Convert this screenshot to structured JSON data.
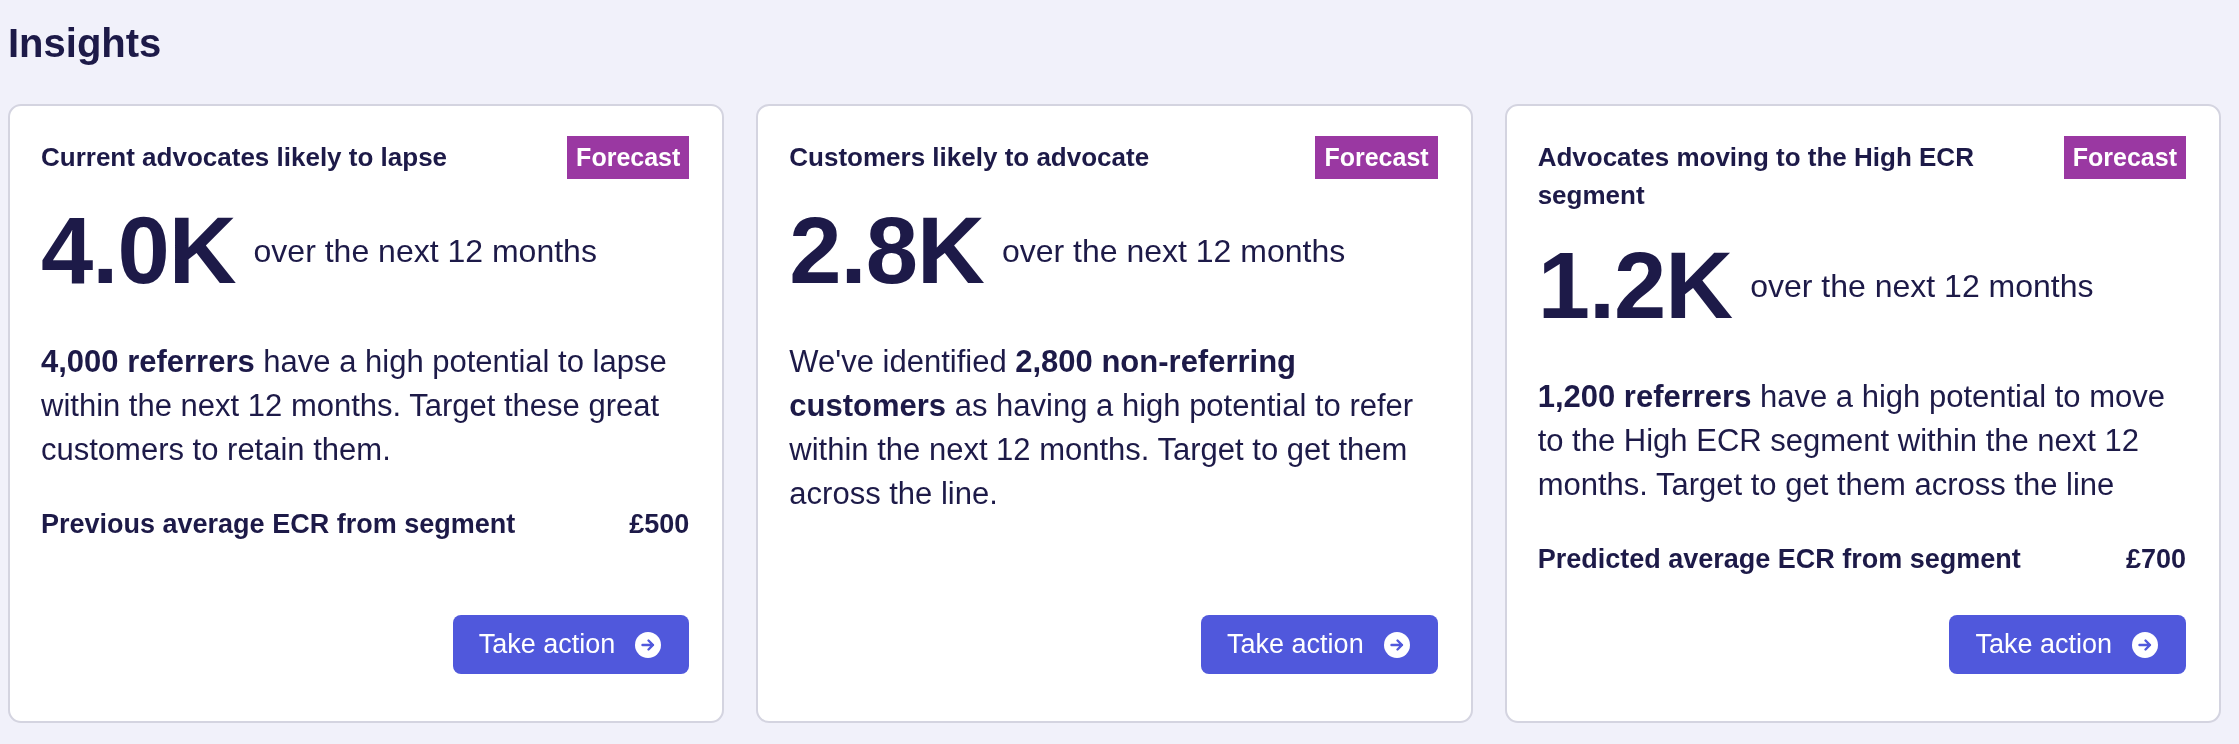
{
  "page": {
    "title": "Insights"
  },
  "cards": [
    {
      "title": "Current advocates likely to lapse",
      "badge": "Forecast",
      "value": "4.0K",
      "period": "over the next 12 months",
      "description": "**4,000 referrers** have a high potential to lapse within the next 12 months. Target these great customers to retain them.",
      "metric": {
        "label": "Previous average ECR from segment",
        "value": "£500"
      },
      "button": "Take action"
    },
    {
      "title": "Customers likely to advocate",
      "badge": "Forecast",
      "value": "2.8K",
      "period": "over the next 12 months",
      "description": "We've identified **2,800 non-referring customers** as having a high potential to refer within the next 12 months. Target to get them across the line.",
      "button": "Take action"
    },
    {
      "title": "Advocates moving to the High ECR segment",
      "badge": "Forecast",
      "value": "1.2K",
      "period": "over the next 12 months",
      "description": "**1,200 referrers** have a high potential to move to the High ECR segment within the next 12 months. Target to get them across the line",
      "metric": {
        "label": "Predicted average ECR from segment",
        "value": "£700"
      },
      "button": "Take action"
    }
  ]
}
